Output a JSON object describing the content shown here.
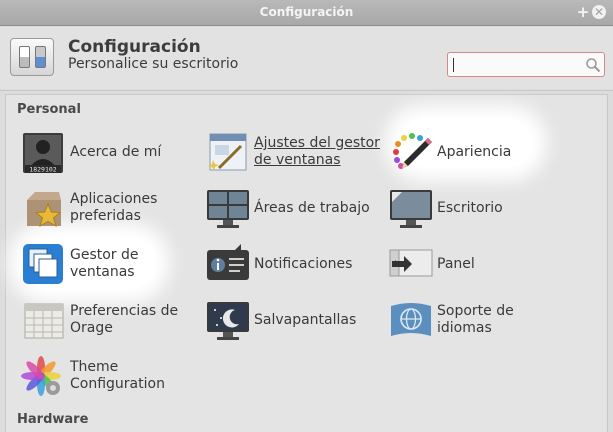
{
  "window": {
    "title": "Configuración"
  },
  "header": {
    "title": "Configuración",
    "subtitle": "Personalice su escritorio",
    "search_placeholder": ""
  },
  "sections": [
    {
      "title": "Personal"
    },
    {
      "title": "Hardware"
    }
  ],
  "items": [
    {
      "label": "Acerca de mí",
      "icon": "about-me-icon",
      "badge": "1829102"
    },
    {
      "label": "Ajustes del gestor de ventanas",
      "icon": "window-manager-tweaks-icon"
    },
    {
      "label": "Apariencia",
      "icon": "appearance-icon"
    },
    {
      "label": "Aplicaciones preferidas",
      "icon": "preferred-applications-icon"
    },
    {
      "label": "Áreas de trabajo",
      "icon": "workspaces-icon"
    },
    {
      "label": "Escritorio",
      "icon": "desktop-icon"
    },
    {
      "label": "Gestor de ventanas",
      "icon": "window-manager-icon"
    },
    {
      "label": "Notificaciones",
      "icon": "notifications-icon"
    },
    {
      "label": "Panel",
      "icon": "panel-icon"
    },
    {
      "label": "Preferencias de Orage",
      "icon": "orage-calendar-icon"
    },
    {
      "label": "Salvapantallas",
      "icon": "screensaver-icon"
    },
    {
      "label": "Soporte de idiomas",
      "icon": "language-support-icon"
    },
    {
      "label": "Theme Configuration",
      "icon": "theme-configuration-icon"
    }
  ],
  "labels_split": {
    "item0": [
      "Acerca de mí"
    ],
    "item1": [
      "Ajustes del gestor",
      "de ventanas"
    ],
    "item2": [
      "Apariencia"
    ],
    "item3": [
      "Aplicaciones",
      "preferidas"
    ],
    "item4": [
      "Áreas de trabajo"
    ],
    "item5": [
      "Escritorio"
    ],
    "item6": [
      "Gestor de",
      "ventanas"
    ],
    "item7": [
      "Notificaciones"
    ],
    "item8": [
      "Panel"
    ],
    "item9": [
      "Preferencias de",
      "Orage"
    ],
    "item10": [
      "Salvapantallas"
    ],
    "item11": [
      "Soporte de",
      "idiomas"
    ],
    "item12": [
      "Theme",
      "Configuration"
    ]
  },
  "colors": {
    "titlebar": "#b0b0b0",
    "search_border": "#d28a8a",
    "highlight": "#ffffff"
  }
}
